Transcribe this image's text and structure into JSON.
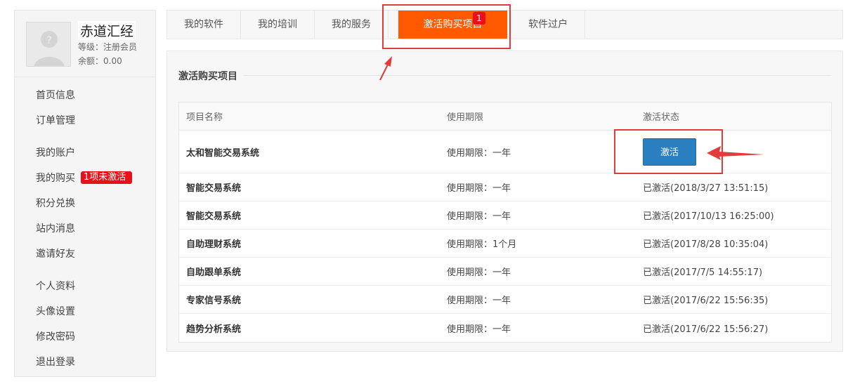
{
  "user": {
    "name": "赤道汇经",
    "level": "等级：注册会员",
    "balance": "余额：0.00"
  },
  "nav": [
    {
      "label": "首页信息"
    },
    {
      "label": "订单管理"
    },
    {
      "label": "我的账户"
    },
    {
      "label": "我的购买",
      "badge": "1项未激活"
    },
    {
      "label": "积分兑换"
    },
    {
      "label": "站内消息"
    },
    {
      "label": "邀请好友"
    },
    {
      "label": "个人资料"
    },
    {
      "label": "头像设置"
    },
    {
      "label": "修改密码"
    },
    {
      "label": "退出登录"
    }
  ],
  "tabs": [
    {
      "label": "我的软件"
    },
    {
      "label": "我的培训"
    },
    {
      "label": "我的服务"
    },
    {
      "label": "激活购买项目",
      "count": "1"
    },
    {
      "label": "软件过户"
    }
  ],
  "section": {
    "title": "激活购买项目"
  },
  "table": {
    "headers": [
      "项目名称",
      "使用期限",
      "激活状态"
    ],
    "rows": [
      {
        "name": "太和智能交易系统",
        "period": "使用期限：一年",
        "status": "",
        "action": "激活"
      },
      {
        "name": "智能交易系统",
        "period": "使用期限：一年",
        "status": "已激活(2018/3/27 13:51:15)"
      },
      {
        "name": "智能交易系统",
        "period": "使用期限：一年",
        "status": "已激活(2017/10/13 16:25:00)"
      },
      {
        "name": "自助理财系统",
        "period": "使用期限：1个月",
        "status": "已激活(2017/8/28 10:35:04)"
      },
      {
        "name": "自助跟单系统",
        "period": "使用期限：一年",
        "status": "已激活(2017/7/5 14:55:17)"
      },
      {
        "name": "专家信号系统",
        "period": "使用期限：一年",
        "status": "已激活(2017/6/22 15:56:35)"
      },
      {
        "name": "趋势分析系统",
        "period": "使用期限：一年",
        "status": "已激活(2017/6/22 15:56:27)"
      }
    ]
  },
  "colors": {
    "accent": "#ff5a00",
    "badge": "#e8101a",
    "button": "#2a7fc0",
    "highlight": "#e23b3b"
  }
}
